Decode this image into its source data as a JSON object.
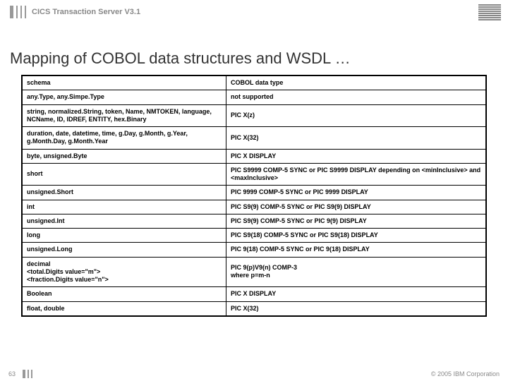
{
  "header": {
    "product": "CICS Transaction Server V3.1"
  },
  "slide": {
    "title": "Mapping of COBOL data structures and WSDL …"
  },
  "table": {
    "header": {
      "col1": "schema",
      "col2": "COBOL data type"
    },
    "rows": [
      {
        "c1": "any.Type, any.Simpe.Type",
        "c2": "not supported"
      },
      {
        "c1": "string, normalized.String, token, Name, NMTOKEN, language, NCName, ID, IDREF, ENTITY, hex.Binary",
        "c2": "PIC X(z)"
      },
      {
        "c1": "duration, date, datetime, time, g.Day, g.Month, g.Year, g.Month.Day, g.Month.Year",
        "c2": "PIC X(32)"
      },
      {
        "c1": "byte, unsigned.Byte",
        "c2": "PIC X DISPLAY"
      },
      {
        "c1": "short",
        "c2": "PIC S9999 COMP-5 SYNC or PIC S9999 DISPLAY depending on <minInclusive> and <maxInclusive>"
      },
      {
        "c1": "unsigned.Short",
        "c2": "PIC 9999 COMP-5 SYNC or PIC 9999 DISPLAY"
      },
      {
        "c1": "int",
        "c2": "PIC S9(9) COMP-5 SYNC or PIC S9(9) DISPLAY"
      },
      {
        "c1": "unsigned.Int",
        "c2": "PIC S9(9) COMP-5 SYNC or PIC 9(9) DISPLAY"
      },
      {
        "c1": "long",
        "c2": "PIC S9(18) COMP-5 SYNC or PIC S9(18) DISPLAY"
      },
      {
        "c1": "unsigned.Long",
        "c2": "PIC 9(18) COMP-5 SYNC or PIC 9(18) DISPLAY"
      },
      {
        "c1": "decimal\n<total.Digits value=\"m\">\n<fraction.Digits value=\"n\">",
        "c2": "PIC 9(p)V9(n) COMP-3\nwhere p=m-n"
      },
      {
        "c1": "Boolean",
        "c2": "PIC X DISPLAY"
      },
      {
        "c1": "float, double",
        "c2": "PIC X(32)"
      }
    ]
  },
  "footer": {
    "page": "63",
    "copyright": "© 2005 IBM Corporation"
  }
}
